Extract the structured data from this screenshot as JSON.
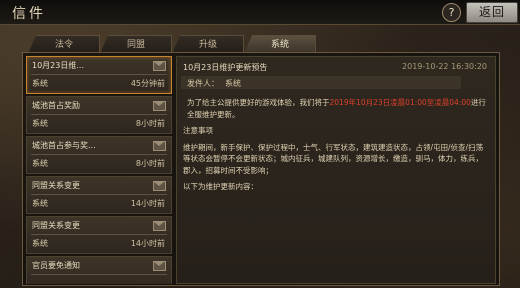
{
  "header": {
    "title": "信件",
    "help_label": "?",
    "back_label": "返回"
  },
  "tabs": [
    {
      "label": "法令",
      "active": false
    },
    {
      "label": "同盟",
      "active": false
    },
    {
      "label": "升级",
      "active": false
    },
    {
      "label": "系统",
      "active": true
    }
  ],
  "mail_list": [
    {
      "subject": "10月23日维...",
      "sender": "系统",
      "time": "45分钟前",
      "selected": true
    },
    {
      "subject": "城池首占奖励",
      "sender": "系统",
      "time": "8小时前",
      "selected": false
    },
    {
      "subject": "城池首占参与奖...",
      "sender": "系统",
      "time": "8小时前",
      "selected": false
    },
    {
      "subject": "同盟关系变更",
      "sender": "系统",
      "time": "14小时前",
      "selected": false
    },
    {
      "subject": "同盟关系变更",
      "sender": "系统",
      "time": "14小时前",
      "selected": false
    },
    {
      "subject": "官员要免通知",
      "sender": "",
      "time": "",
      "selected": false
    }
  ],
  "detail": {
    "title": "10月23日维护更新预告",
    "date": "2019-10-22 16:30:20",
    "sender_label": "发件人：",
    "sender": "系统",
    "para1_a": "为了给主公提供更好的游戏体验，我们将于",
    "para1_red": "2019年10月23日凌晨01:00至凌晨04:00",
    "para1_b": "进行全服维护更新。",
    "notice_title": "注意事项",
    "notice_body": "维护期间，新手保护、保护过程中，士气、行军状态，建筑建造状态，占领/屯田/侦查/扫荡等状态会暂停不会更新状态；城内征兵，城建队列，资源增长，缴造，驯马，体力，练兵，郡入，招募时间不受影响；",
    "footer": "以下为维护更新内容："
  },
  "colors": {
    "accent": "#c9852e",
    "highlight_red": "#e0402a"
  }
}
